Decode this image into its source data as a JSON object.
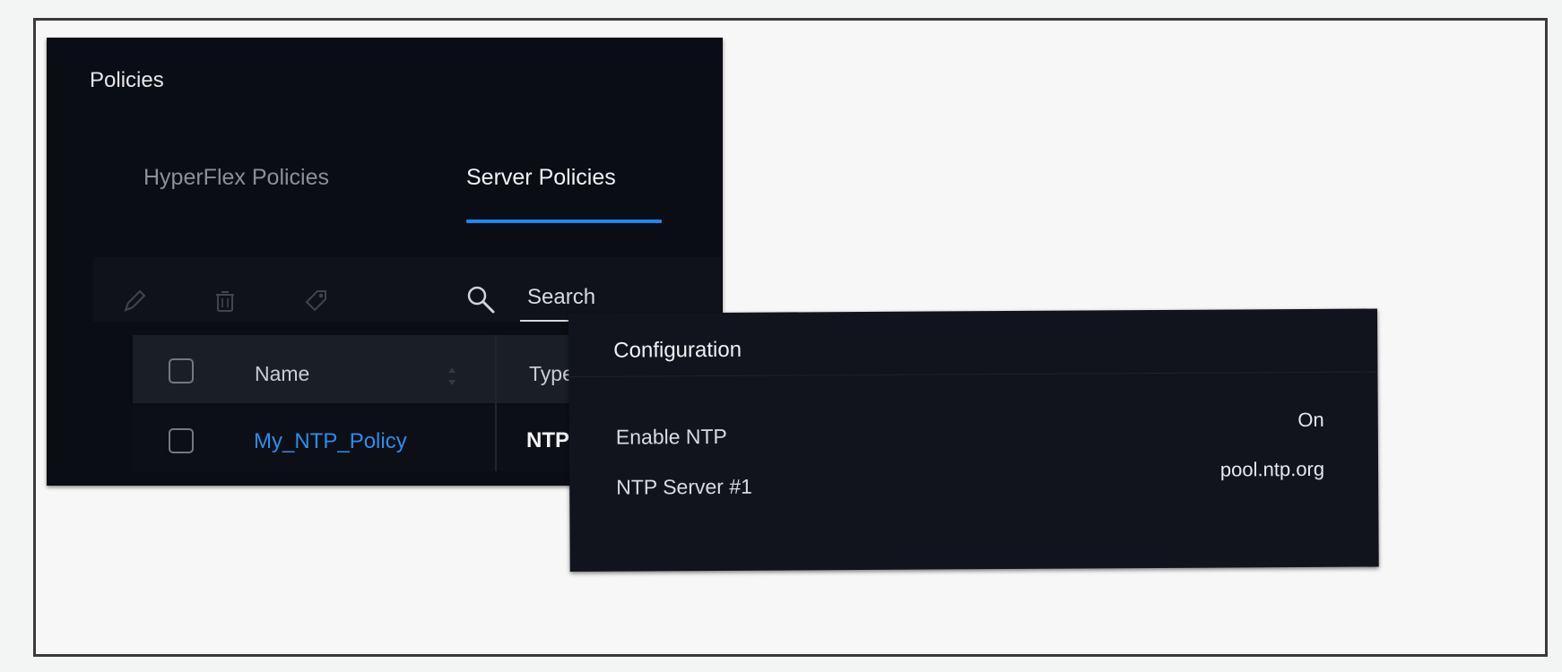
{
  "panel": {
    "title": "Policies",
    "tabs": [
      {
        "label": "HyperFlex Policies",
        "active": false
      },
      {
        "label": "Server Policies",
        "active": true
      }
    ],
    "accent_color": "#1a88f0"
  },
  "toolbar": {
    "icons": [
      "edit-icon",
      "trash-icon",
      "tag-icon",
      "search-icon"
    ],
    "search_placeholder": "Search"
  },
  "table": {
    "headers": [
      "Name",
      "Type"
    ],
    "rows": [
      {
        "name": "My_NTP_Policy",
        "type": "NTP"
      }
    ],
    "link_color": "#2a8df0"
  },
  "configuration": {
    "title": "Configuration",
    "fields": [
      {
        "label": "Enable NTP",
        "value": "On"
      },
      {
        "label": "NTP Server #1",
        "value": "pool.ntp.org"
      }
    ]
  }
}
